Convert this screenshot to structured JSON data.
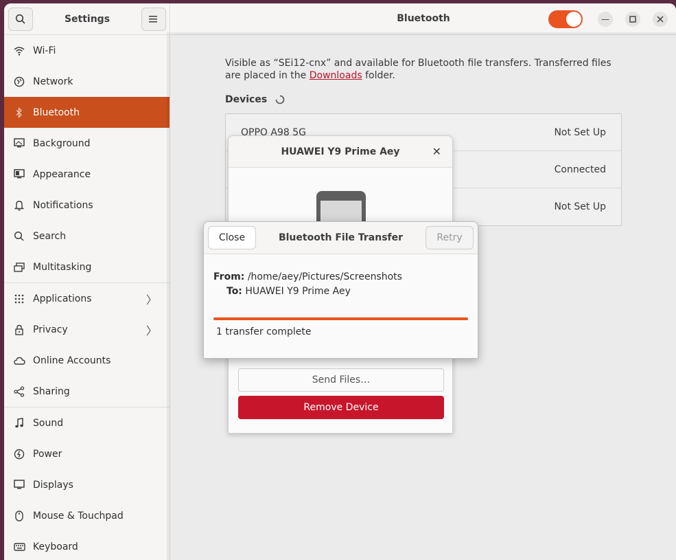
{
  "sidebar": {
    "title": "Settings",
    "items": [
      {
        "label": "Wi-Fi",
        "icon": "wifi-icon"
      },
      {
        "label": "Network",
        "icon": "network-icon"
      },
      {
        "label": "Bluetooth",
        "icon": "bluetooth-icon"
      },
      {
        "label": "Background",
        "icon": "background-icon"
      },
      {
        "label": "Appearance",
        "icon": "appearance-icon"
      },
      {
        "label": "Notifications",
        "icon": "bell-icon"
      },
      {
        "label": "Search",
        "icon": "search-icon"
      },
      {
        "label": "Multitasking",
        "icon": "multitasking-icon"
      },
      {
        "label": "Applications",
        "icon": "grid-icon"
      },
      {
        "label": "Privacy",
        "icon": "lock-icon"
      },
      {
        "label": "Online Accounts",
        "icon": "cloud-icon"
      },
      {
        "label": "Sharing",
        "icon": "share-icon"
      },
      {
        "label": "Sound",
        "icon": "music-note-icon"
      },
      {
        "label": "Power",
        "icon": "power-icon"
      },
      {
        "label": "Displays",
        "icon": "display-icon"
      },
      {
        "label": "Mouse & Touchpad",
        "icon": "mouse-icon"
      },
      {
        "label": "Keyboard",
        "icon": "keyboard-icon"
      }
    ]
  },
  "main": {
    "title": "Bluetooth",
    "bluetooth_enabled": true,
    "desc_prefix": "Visible as “SEi12-cnx” and available for Bluetooth file transfers. Transferred files are placed in the ",
    "desc_link": "Downloads",
    "desc_suffix": " folder.",
    "devices_label": "Devices",
    "devices": [
      {
        "name": "OPPO A98 5G",
        "status": "Not Set Up"
      },
      {
        "name": "",
        "status": "Connected"
      },
      {
        "name": "",
        "status": "Not Set Up"
      }
    ]
  },
  "device_dialog": {
    "title": "HUAWEI Y9 Prime Aey",
    "send_label": "Send Files…",
    "remove_label": "Remove Device"
  },
  "transfer_dialog": {
    "title": "Bluetooth File Transfer",
    "close_label": "Close",
    "retry_label": "Retry",
    "from_label": "From:",
    "from_value": "/home/aey/Pictures/Screenshots",
    "to_label": "To:",
    "to_value": "HUAWEI Y9 Prime Aey",
    "progress": 1.0,
    "status": "1 transfer complete"
  },
  "colors": {
    "accent": "#e95420",
    "selected": "#c94f1c",
    "destructive": "#c7162b"
  }
}
